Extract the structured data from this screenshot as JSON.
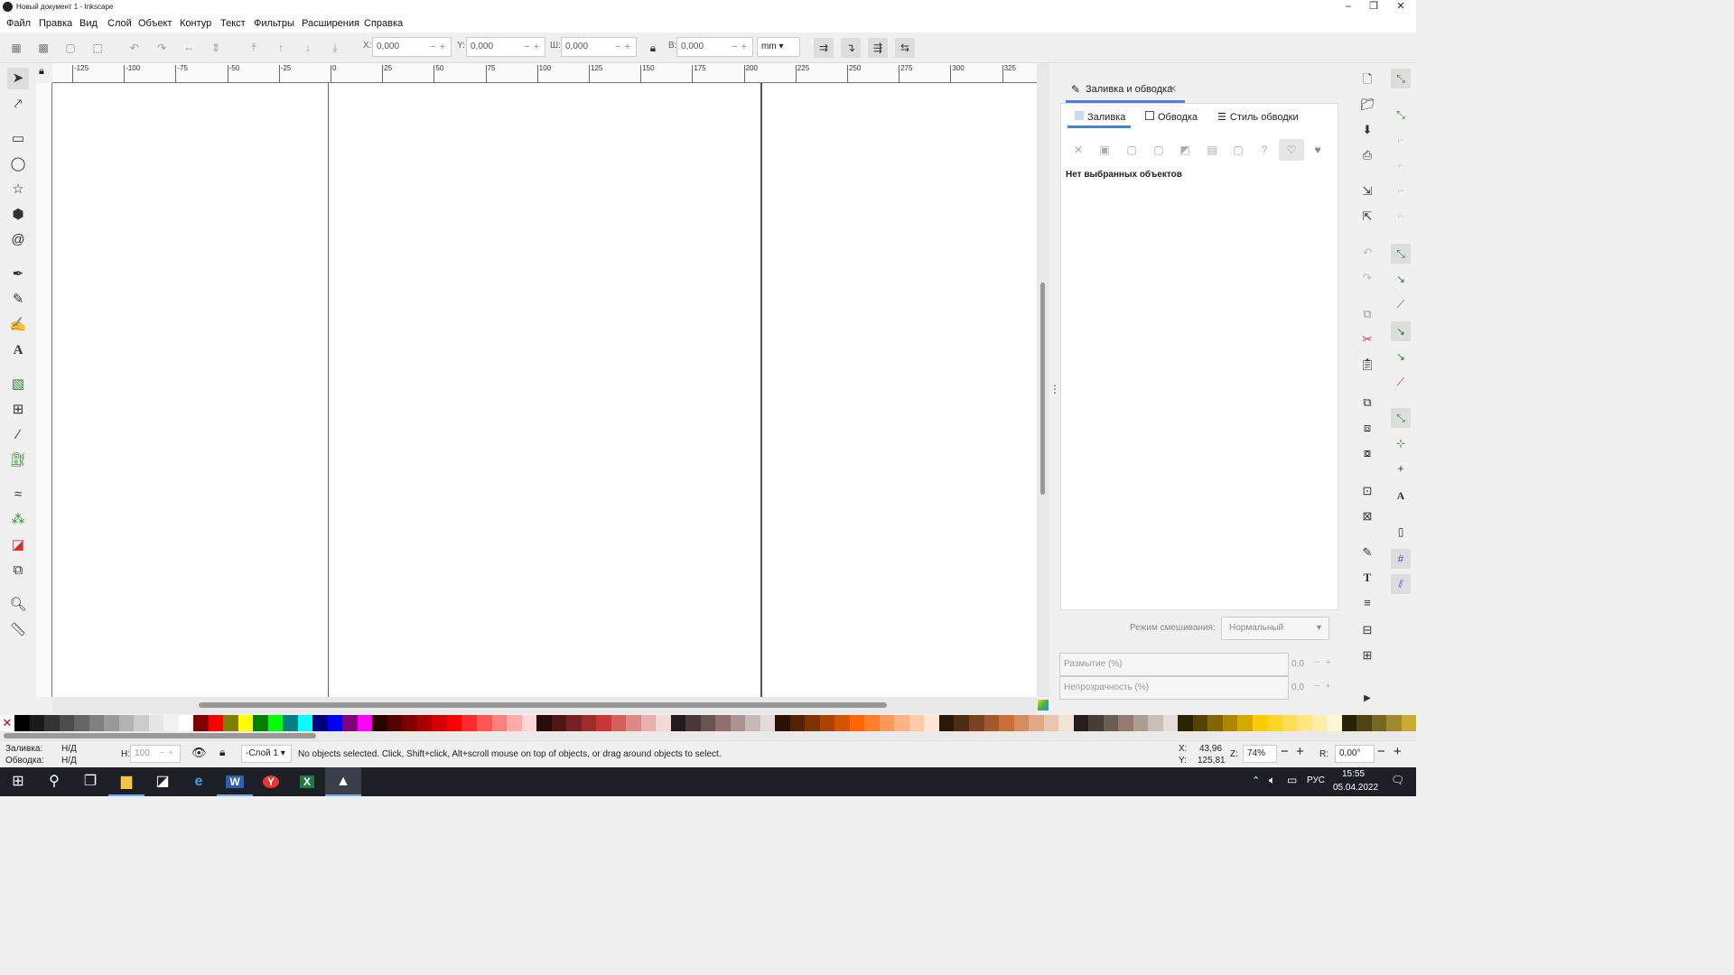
{
  "window": {
    "title": "Новый документ 1 - Inkscape"
  },
  "menu": [
    "Файл",
    "Правка",
    "Вид",
    "Слой",
    "Объект",
    "Контур",
    "Текст",
    "Фильтры",
    "Расширения",
    "Справка"
  ],
  "toolbar": {
    "x_label": "X:",
    "x_value": "0,000",
    "y_label": "Y:",
    "y_value": "0,000",
    "w_label": "Ш:",
    "w_value": "0,000",
    "h_label": "В:",
    "h_value": "0,000",
    "unit": "mm"
  },
  "ruler": {
    "h_ticks": [
      "-125",
      "-100",
      "-75",
      "-50",
      "-25",
      "0",
      "25",
      "50",
      "75",
      "100",
      "125",
      "150",
      "175",
      "200",
      "225",
      "250",
      "275",
      "300",
      "325"
    ]
  },
  "dock": {
    "tab_title": "Заливка и обводка",
    "subtabs": [
      "Заливка",
      "Обводка",
      "Стиль обводки"
    ],
    "no_selection": "Нет выбранных объектов",
    "blend_label": "Режим смешивания:",
    "blend_value": "Нормальный",
    "blur_label": "Размытие (%)",
    "blur_value": "0,0",
    "opacity_label": "Непрозрачность (%)",
    "opacity_value": "0,0"
  },
  "palette": [
    "#000000",
    "#1a1a1a",
    "#333333",
    "#4d4d4d",
    "#666666",
    "#808080",
    "#999999",
    "#b3b3b3",
    "#cccccc",
    "#e6e6e6",
    "#f2f2f2",
    "#ffffff",
    "#800000",
    "#ff0000",
    "#808000",
    "#ffff00",
    "#008000",
    "#00ff00",
    "#008080",
    "#00ffff",
    "#000080",
    "#0000ff",
    "#800080",
    "#ff00ff",
    "#2b0000",
    "#550000",
    "#800000",
    "#aa0000",
    "#d40000",
    "#ff0000",
    "#ff2a2a",
    "#ff5555",
    "#ff8080",
    "#ffaaaa",
    "#ffd5d5",
    "#280b0b",
    "#501616",
    "#782121",
    "#a02c2c",
    "#c83737",
    "#d35f5f",
    "#de8787",
    "#e9afaf",
    "#f4d7d7",
    "#241c1c",
    "#483737",
    "#6c5353",
    "#916f6f",
    "#ac9393",
    "#c8b7b7",
    "#e3dbdb",
    "#2b1100",
    "#552200",
    "#803300",
    "#aa4400",
    "#d45500",
    "#ff6600",
    "#ff7f2a",
    "#ff9955",
    "#ffb380",
    "#ffccaa",
    "#ffe6d5",
    "#28170b",
    "#502d16",
    "#784421",
    "#a05a2c",
    "#c87137",
    "#d38d5f",
    "#deaa87",
    "#e9c6af",
    "#f4e3d7",
    "#241f1c",
    "#483e37",
    "#6c5d53",
    "#917c6f",
    "#ac9d93",
    "#c8beb7",
    "#e3dedb",
    "#2b2200",
    "#554400",
    "#806600",
    "#aa8800",
    "#d4aa00",
    "#ffcc00",
    "#ffd42a",
    "#ffdd55",
    "#ffe680",
    "#ffeeaa",
    "#fff6d5",
    "#28220b",
    "#504416",
    "#786721",
    "#a0892c",
    "#c8ab37"
  ],
  "status": {
    "fill_label": "Заливка:",
    "fill_value": "Н/Д",
    "stroke_label": "Обводка:",
    "stroke_value": "Н/Д",
    "h_label": "Н:",
    "h_value": "100",
    "layer": "-Слой 1",
    "message": "No objects selected. Click, Shift+click, Alt+scroll mouse on top of objects, or drag around objects to select.",
    "x_label": "X:",
    "x_value": "43,96",
    "y_label": "Y:",
    "y_value": "125,81",
    "zoom_label": "Z:",
    "zoom_value": "74%",
    "rot_label": "R:",
    "rot_value": "0,00°"
  },
  "taskbar": {
    "lang": "РУС",
    "time": "15:55",
    "date": "05.04.2022"
  }
}
